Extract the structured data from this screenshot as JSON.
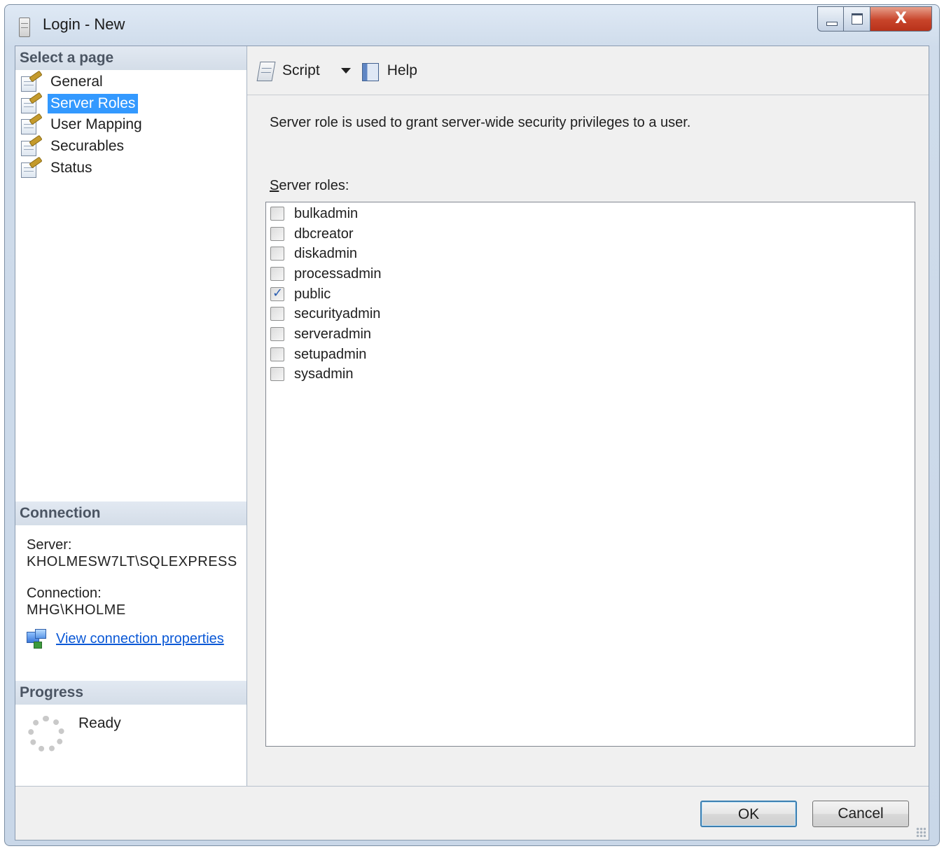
{
  "window": {
    "title": "Login - New",
    "close_symbol": "X"
  },
  "left_pane": {
    "select_page_header": "Select a page",
    "pages": [
      {
        "label": "General",
        "icon": "page-settings-icon",
        "selected": false
      },
      {
        "label": "Server Roles",
        "icon": "page-settings-icon",
        "selected": true
      },
      {
        "label": "User Mapping",
        "icon": "page-settings-icon",
        "selected": false
      },
      {
        "label": "Securables",
        "icon": "page-settings-icon",
        "selected": false
      },
      {
        "label": "Status",
        "icon": "page-settings-icon",
        "selected": false
      }
    ],
    "connection_header": "Connection",
    "server_label": "Server:",
    "server_value": "KHOLMESW7LT\\SQLEXPRESS",
    "connection_label": "Connection:",
    "connection_value": "MHG\\KHOLME",
    "view_properties_link": "View connection properties",
    "progress_header": "Progress",
    "progress_status": "Ready"
  },
  "toolbar": {
    "script_label": "Script",
    "help_label": "Help"
  },
  "main": {
    "description": "Server role is used to grant server-wide security privileges to a user.",
    "roles_label_accel": "S",
    "roles_label_rest": "erver roles:",
    "roles": [
      {
        "name": "bulkadmin",
        "checked": false
      },
      {
        "name": "dbcreator",
        "checked": false
      },
      {
        "name": "diskadmin",
        "checked": false
      },
      {
        "name": "processadmin",
        "checked": false
      },
      {
        "name": "public",
        "checked": true
      },
      {
        "name": "securityadmin",
        "checked": false
      },
      {
        "name": "serveradmin",
        "checked": false
      },
      {
        "name": "setupadmin",
        "checked": false
      },
      {
        "name": "sysadmin",
        "checked": false
      }
    ]
  },
  "footer": {
    "ok_label": "OK",
    "cancel_label": "Cancel"
  },
  "colors": {
    "selection": "#3399ff",
    "link": "#0a58d6",
    "close_button": "#c8442a"
  }
}
